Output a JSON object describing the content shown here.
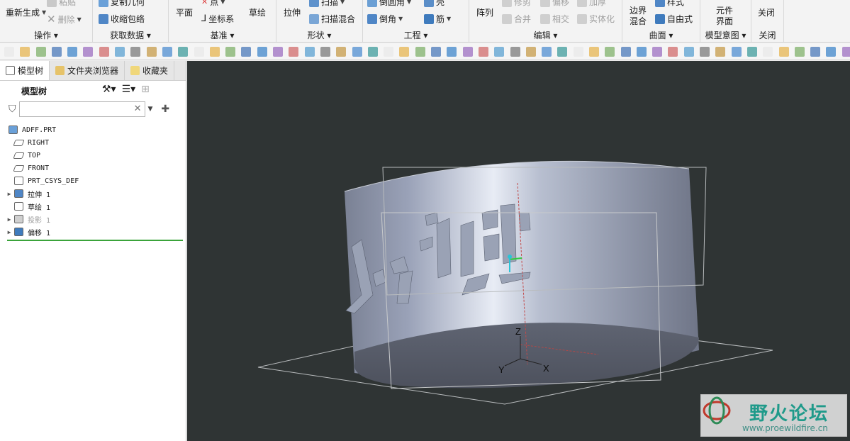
{
  "ribbon": {
    "regenerate": "重新生成",
    "paste": "粘贴",
    "delete": "删除",
    "copy_geometry": "复制几何",
    "shrinkwrap": "收缩包络",
    "plane": "平面",
    "point": "点",
    "csys": "坐标系",
    "sketch": "草绘",
    "extrude": "拉伸",
    "sweep": "扫描",
    "swept_blend": "扫描混合",
    "round": "倒圆角",
    "chamfer": "倒角",
    "shell": "壳",
    "rib": "筋",
    "pattern": "阵列",
    "trim": "修剪",
    "offset": "偏移",
    "thicken": "加厚",
    "merge": "合并",
    "intersect": "相交",
    "solidify": "实体化",
    "boundary_blend_1": "边界",
    "boundary_blend_2": "混合",
    "style": "样式",
    "freestyle": "自由式",
    "component_interface_1": "元件",
    "component_interface_2": "界面",
    "close": "关闭",
    "groups": {
      "operations": "操作",
      "get_data": "获取数据",
      "datum": "基准",
      "shapes": "形状",
      "engineering": "工程",
      "editing": "编辑",
      "surfaces": "曲面",
      "model_intent": "模型意图",
      "close": "关闭"
    }
  },
  "panel": {
    "tabs": [
      "模型树",
      "文件夹浏览器",
      "收藏夹"
    ],
    "tree_title": "模型树",
    "search_placeholder": ""
  },
  "tree": [
    {
      "label": "ADFF.PRT",
      "icon": "part-icon",
      "expandable": false,
      "indent": 0,
      "disabled": false
    },
    {
      "label": "RIGHT",
      "icon": "datum-plane-icon",
      "expandable": false,
      "indent": 1,
      "disabled": false
    },
    {
      "label": "TOP",
      "icon": "datum-plane-icon",
      "expandable": false,
      "indent": 1,
      "disabled": false
    },
    {
      "label": "FRONT",
      "icon": "datum-plane-icon",
      "expandable": false,
      "indent": 1,
      "disabled": false
    },
    {
      "label": "PRT_CSYS_DEF",
      "icon": "csys-icon",
      "expandable": false,
      "indent": 1,
      "disabled": false
    },
    {
      "label": "拉伸 1",
      "icon": "extrude-icon",
      "expandable": true,
      "indent": 1,
      "disabled": false
    },
    {
      "label": "草绘 1",
      "icon": "sketch-icon",
      "expandable": false,
      "indent": 1,
      "disabled": false
    },
    {
      "label": "投影 1",
      "icon": "project-icon",
      "expandable": true,
      "indent": 1,
      "disabled": true
    },
    {
      "label": "偏移 1",
      "icon": "offset-icon",
      "expandable": true,
      "indent": 1,
      "disabled": false
    }
  ],
  "viewport": {
    "axis_z": "Z",
    "axis_y": "Y",
    "axis_x": "X",
    "background": "#2f3434"
  },
  "watermark": {
    "title": "野火论坛",
    "url": "www.proewildfire.cn"
  },
  "colors": {
    "accent_green": "#3aa33a",
    "watermark_teal": "#1f9a8a"
  }
}
